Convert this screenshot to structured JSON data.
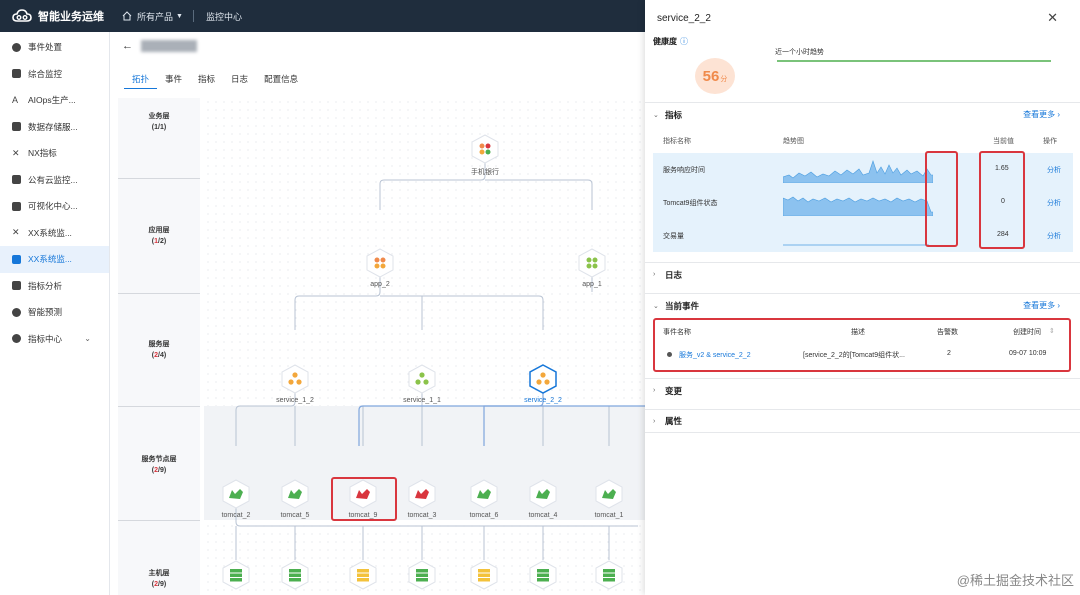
{
  "topbar": {
    "title": "智能业务运维",
    "product_menu": "所有产品",
    "monitor_center": "监控中心"
  },
  "sidebar": {
    "items": [
      {
        "label": "事件处置",
        "icon": "gear-icon",
        "active": false
      },
      {
        "label": "综合监控",
        "icon": "monitor-icon",
        "active": false
      },
      {
        "label": "AIOps生产...",
        "icon": "ai-icon",
        "active": false
      },
      {
        "label": "数据存储服...",
        "icon": "database-icon",
        "active": false
      },
      {
        "label": "NX指标",
        "icon": "nx-icon",
        "active": false
      },
      {
        "label": "公有云监控...",
        "icon": "cloud-icon",
        "active": false
      },
      {
        "label": "可视化中心...",
        "icon": "screen-icon",
        "active": false
      },
      {
        "label": "XX系统监...",
        "icon": "system-icon",
        "active": false
      },
      {
        "label": "XX系统监...",
        "icon": "system-icon",
        "active": true
      },
      {
        "label": "指标分析",
        "icon": "chart-icon",
        "active": false
      },
      {
        "label": "智能预测",
        "icon": "predict-icon",
        "active": false
      },
      {
        "label": "指标中心",
        "icon": "metric-center-icon",
        "active": false
      }
    ]
  },
  "main": {
    "tabs": [
      "拓扑",
      "事件",
      "指标",
      "日志",
      "配置信息"
    ],
    "layers": [
      {
        "name": "业务层",
        "count": "(1/1)",
        "alert": "",
        "rest": ""
      },
      {
        "name": "应用层",
        "count": "",
        "alert": "1",
        "rest": "/2"
      },
      {
        "name": "服务层",
        "count": "",
        "alert": "2",
        "rest": "/4"
      },
      {
        "name": "服务节点层",
        "count": "",
        "alert": "2",
        "rest": "/9"
      },
      {
        "name": "主机层",
        "count": "",
        "alert": "2",
        "rest": "/9"
      }
    ],
    "nodes": {
      "biz": "手机银行",
      "app_2": "app_2",
      "app_1": "app_1",
      "service_1_2": "service_1_2",
      "service_1_1": "service_1_1",
      "service_2_2": "service_2_2",
      "tomcat_2": "tomcat_2",
      "tomcat_5": "tomcat_5",
      "tomcat_9": "tomcat_9",
      "tomcat_3": "tomcat_3",
      "tomcat_6": "tomcat_6",
      "tomcat_4": "tomcat_4",
      "tomcat_1": "tomcat_1"
    }
  },
  "panel": {
    "title": "service_2_2",
    "health_label": "健康度",
    "score": "56",
    "score_unit": "分",
    "trend_label": "近一个小时趋势",
    "sections": {
      "metrics": "指标",
      "logs": "日志",
      "events": "当前事件",
      "changes": "变更",
      "attrs": "属性"
    },
    "see_more": "查看更多",
    "metric_headers": {
      "name": "指标名称",
      "trend": "趋势图",
      "value": "当前值",
      "op": "操作"
    },
    "metrics": [
      {
        "name": "服务响应时间",
        "value": "1.65",
        "op": "分析"
      },
      {
        "name": "Tomcat9组件状态",
        "value": "0",
        "op": "分析"
      },
      {
        "name": "交易量",
        "value": "284",
        "op": "分析"
      }
    ],
    "event_headers": {
      "name": "事件名称",
      "desc": "描述",
      "count": "告警数",
      "time": "创建时间"
    },
    "events": [
      {
        "name": "服务_v2 & service_2_2",
        "desc": "[service_2_2的[Tomcat9组件状...",
        "count": "2",
        "time": "09-07 10:09"
      }
    ]
  },
  "watermark": "@稀土掘金技术社区",
  "colors": {
    "accent": "#1677d9",
    "alert": "#d9363e",
    "topbar": "#1f2d3d",
    "score": "#f08a4b"
  }
}
